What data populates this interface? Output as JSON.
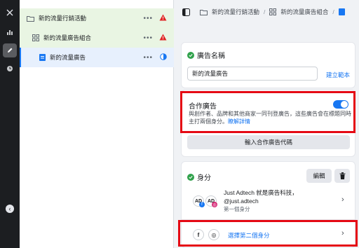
{
  "rail": {
    "icons": [
      "close-icon",
      "chart-icon",
      "edit-icon",
      "clock-icon"
    ],
    "bottom_icon": "chevron-left-icon"
  },
  "tree": {
    "items": [
      {
        "label": "新的流量行銷活動",
        "icon": "folder-icon",
        "status": "warning"
      },
      {
        "label": "新的流量廣告組合",
        "icon": "grid-icon",
        "status": "warning"
      },
      {
        "label": "新的流量廣告",
        "icon": "ad-icon",
        "status": "partial"
      }
    ],
    "more": "•••"
  },
  "breadcrumb": {
    "campaign": "新的流量行銷活動",
    "adset": "新的流量廣告組合"
  },
  "ad_name": {
    "title": "廣告名稱",
    "value": "新的流量廣告",
    "template_link": "建立範本"
  },
  "partnership": {
    "title": "合作廣告",
    "desc": "與創作者、品牌和其他商家一同刊登廣告，這些廣告會在標題同時主打兩個身分。",
    "learn_more": "瞭解詳情",
    "code_button": "輸入合作廣告代碼",
    "enabled": true
  },
  "identity": {
    "title": "身分",
    "edit": "編輯",
    "primary_name": "Just Adtech 就是廣告科技，",
    "primary_handle": "@just.adtech",
    "primary_role": "第一個身分",
    "avatar_text": "AD",
    "choose_second": "選擇第二個身分"
  },
  "colors": {
    "accent": "#1877f2",
    "warning": "#e02424",
    "success": "#31a24c",
    "highlight": "#e50914"
  }
}
